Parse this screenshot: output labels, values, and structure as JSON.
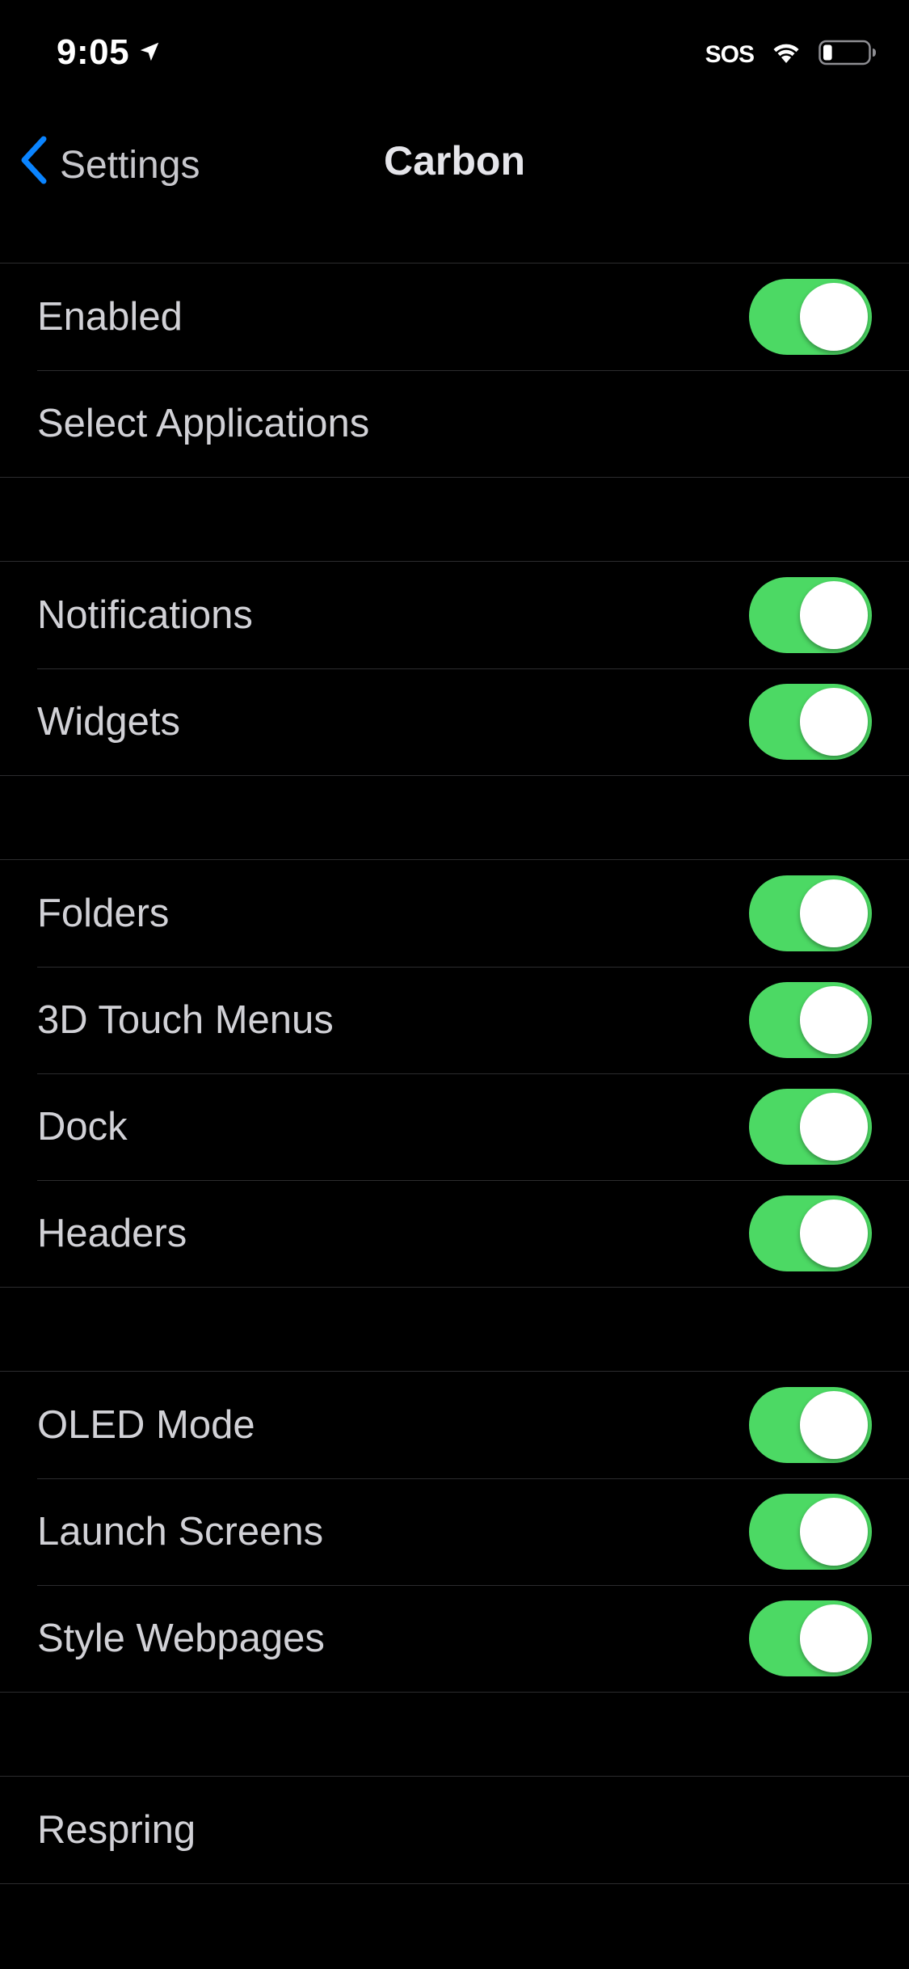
{
  "status_bar": {
    "time": "9:05",
    "sos": "SOS",
    "icons": [
      "location-arrow-icon",
      "wifi-icon",
      "battery-icon"
    ],
    "battery_level": 0.2
  },
  "nav": {
    "back_label": "Settings",
    "title": "Carbon",
    "accent_color": "#0a84ff"
  },
  "toggle_on_color": "#4cd964",
  "sections": [
    {
      "rows": [
        {
          "label": "Enabled",
          "type": "toggle",
          "on": true
        },
        {
          "label": "Select Applications",
          "type": "link"
        }
      ]
    },
    {
      "rows": [
        {
          "label": "Notifications",
          "type": "toggle",
          "on": true
        },
        {
          "label": "Widgets",
          "type": "toggle",
          "on": true
        }
      ]
    },
    {
      "rows": [
        {
          "label": "Folders",
          "type": "toggle",
          "on": true
        },
        {
          "label": "3D Touch Menus",
          "type": "toggle",
          "on": true
        },
        {
          "label": "Dock",
          "type": "toggle",
          "on": true
        },
        {
          "label": "Headers",
          "type": "toggle",
          "on": true
        }
      ]
    },
    {
      "rows": [
        {
          "label": "OLED Mode",
          "type": "toggle",
          "on": true
        },
        {
          "label": "Launch Screens",
          "type": "toggle",
          "on": true
        },
        {
          "label": "Style Webpages",
          "type": "toggle",
          "on": true
        }
      ]
    },
    {
      "rows": [
        {
          "label": "Respring",
          "type": "button"
        }
      ]
    }
  ]
}
